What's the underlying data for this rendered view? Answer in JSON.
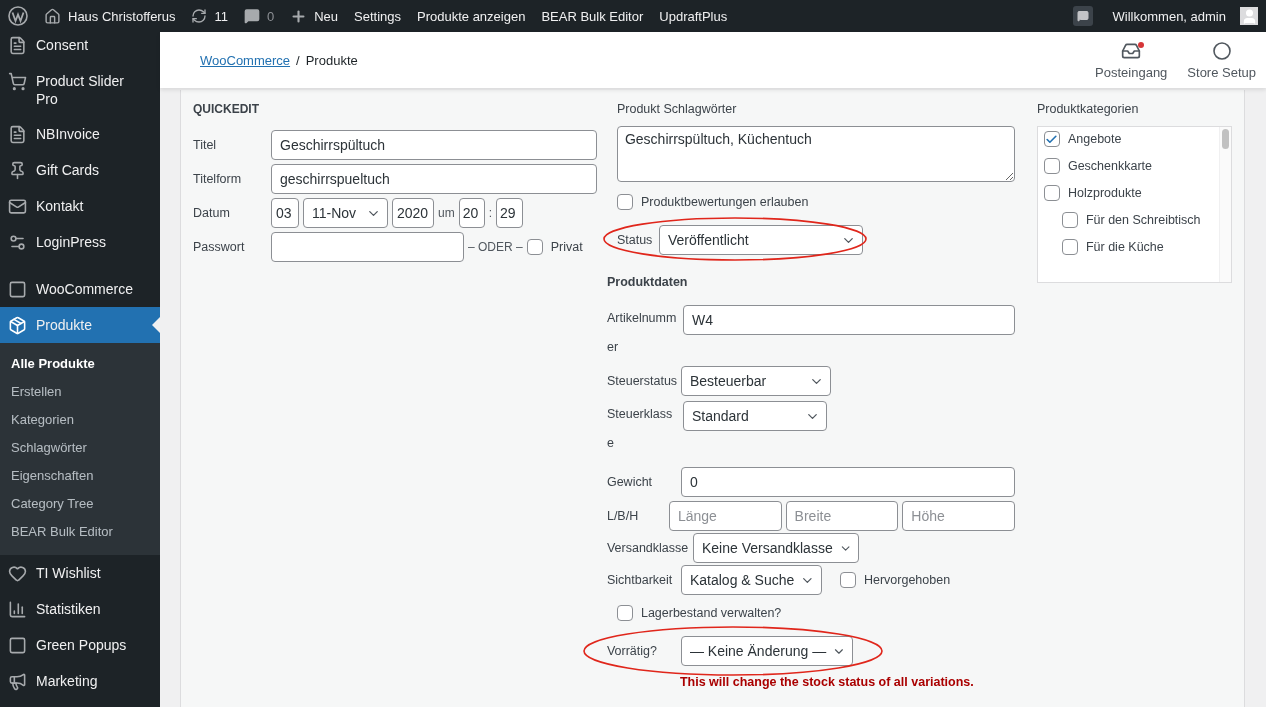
{
  "admin_bar": {
    "site": "Haus Christofferus",
    "updates": "11",
    "comments": "0",
    "new": "Neu",
    "links": [
      "Settings",
      "Produkte anzeigen",
      "BEAR Bulk Editor",
      "UpdraftPlus"
    ],
    "greeting": "Willkommen, admin"
  },
  "sidebar": {
    "items": [
      {
        "label": "Consent",
        "selected": false
      },
      {
        "label": "Product Slider Pro",
        "selected": false
      },
      {
        "label": "NBInvoice",
        "selected": false
      },
      {
        "label": "Gift Cards",
        "selected": false
      },
      {
        "label": "Kontakt",
        "selected": false
      },
      {
        "label": "LoginPress",
        "selected": false
      },
      {
        "label": "WooCommerce",
        "selected": false
      },
      {
        "label": "Produkte",
        "selected": true,
        "children": [
          {
            "label": "Alle Produkte",
            "selected": true
          },
          {
            "label": "Erstellen",
            "selected": false
          },
          {
            "label": "Kategorien",
            "selected": false
          },
          {
            "label": "Schlagwörter",
            "selected": false
          },
          {
            "label": "Eigenschaften",
            "selected": false
          },
          {
            "label": "Category Tree",
            "selected": false
          },
          {
            "label": "BEAR Bulk Editor",
            "selected": false
          }
        ]
      },
      {
        "label": "TI Wishlist",
        "selected": false
      },
      {
        "label": "Statistiken",
        "selected": false
      },
      {
        "label": "Green Popups",
        "selected": false
      },
      {
        "label": "Marketing",
        "selected": false
      }
    ]
  },
  "header": {
    "breadcrumb": {
      "link": "WooCommerce",
      "separator": "/",
      "current": "Produkte"
    },
    "actions": [
      {
        "label": "Posteingang",
        "unread": true
      },
      {
        "label": "Store Setup",
        "unread": false
      }
    ]
  },
  "quickedit": {
    "heading": "QUICKEDIT",
    "title": {
      "label": "Titel",
      "value": "Geschirrspültuch"
    },
    "slug": {
      "label": "Titelform",
      "value": "geschirrspueltuch"
    },
    "date": {
      "label": "Datum",
      "day": "03",
      "month": "11-Nov",
      "year": "2020",
      "at": "um",
      "hour": "20",
      "separator": ":",
      "minute": "29"
    },
    "password": {
      "label": "Passwort",
      "or_text": "– ODER –",
      "private_label": "Privat",
      "private_checked": false
    },
    "tags": {
      "label": "Produkt Schlagwörter",
      "value": "Geschirrspültuch, Küchentuch"
    },
    "reviews": {
      "label": "Produktbewertungen erlauben",
      "checked": false
    },
    "status": {
      "label": "Status",
      "value": "Veröffentlicht",
      "highlighted": true
    },
    "product_data": {
      "heading": "Produktdaten",
      "sku": {
        "label": "Artikelnummer",
        "value": "W4"
      },
      "tax_status": {
        "label": "Steuerstatus",
        "value": "Besteuerbar"
      },
      "tax_class": {
        "label": "Steuerklasse",
        "value": "Standard"
      },
      "weight": {
        "label": "Gewicht",
        "value": "0"
      },
      "dimensions": {
        "label": "L/B/H",
        "placeholders": [
          "Länge",
          "Breite",
          "Höhe"
        ]
      },
      "shipping_class": {
        "label": "Versandklasse",
        "value": "Keine Versandklasse"
      },
      "visibility": {
        "label": "Sichtbarkeit",
        "value": "Katalog & Suche",
        "featured_label": "Hervorgehoben",
        "featured_checked": false
      },
      "manage_stock": {
        "label": "Lagerbestand verwalten?",
        "checked": false
      },
      "stock_status": {
        "label": "Vorrätig?",
        "value": "— Keine Änderung —",
        "highlighted": true,
        "warning": "This will change the stock status of all variations."
      }
    },
    "categories": {
      "label": "Produktkategorien",
      "items": [
        {
          "label": "Angebote",
          "checked": true
        },
        {
          "label": "Geschenkkarte",
          "checked": false
        },
        {
          "label": "Holzprodukte",
          "checked": false,
          "children": [
            {
              "label": "Für den Schreibtisch",
              "checked": false
            },
            {
              "label": "Für die Küche",
              "checked": false
            }
          ]
        }
      ]
    }
  }
}
